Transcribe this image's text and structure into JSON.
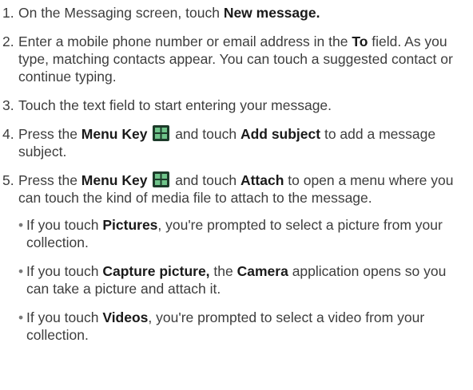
{
  "steps": [
    {
      "num": "1.",
      "t1": "On the Messaging screen, touch ",
      "b1": "New message."
    },
    {
      "num": "2.",
      "t1": "Enter a mobile phone number or email address in the ",
      "b1": "To",
      "t2": " field. As you type, matching contacts appear. You can touch a suggested contact or continue typing."
    },
    {
      "num": "3.",
      "t1": "Touch the text field to start entering your message."
    },
    {
      "num": "4.",
      "t1": "Press the ",
      "b1": "Menu Key",
      "icon": "menu-key-icon",
      "t2": " and touch ",
      "b2": "Add subject",
      "t3": " to add a message subject."
    },
    {
      "num": "5.",
      "t1": "Press the ",
      "b1": "Menu Key",
      "icon": "menu-key-icon",
      "t2": " and touch ",
      "b2": "Attach",
      "t3": " to open a menu where you can touch the kind of media file to attach to the message."
    }
  ],
  "bullets": [
    {
      "dot": "•",
      "t1": "If you touch ",
      "b1": "Pictures",
      "t2": ", you're prompted to select a picture from your collection."
    },
    {
      "dot": "•",
      "t1": "If you touch ",
      "b1": "Capture picture,",
      "t2": " the ",
      "b2": "Camera",
      "t3": " application opens so you can take a picture and attach it."
    },
    {
      "dot": "•",
      "t1": "If you touch ",
      "b1": "Videos",
      "t2": ", you're prompted to select a video from your collection."
    }
  ],
  "colors": {
    "text": "#3d3d3d",
    "emphasis": "#1a1a1a",
    "icon_bg": "#1d3a2a",
    "icon_tiles": "#6fc48a"
  }
}
